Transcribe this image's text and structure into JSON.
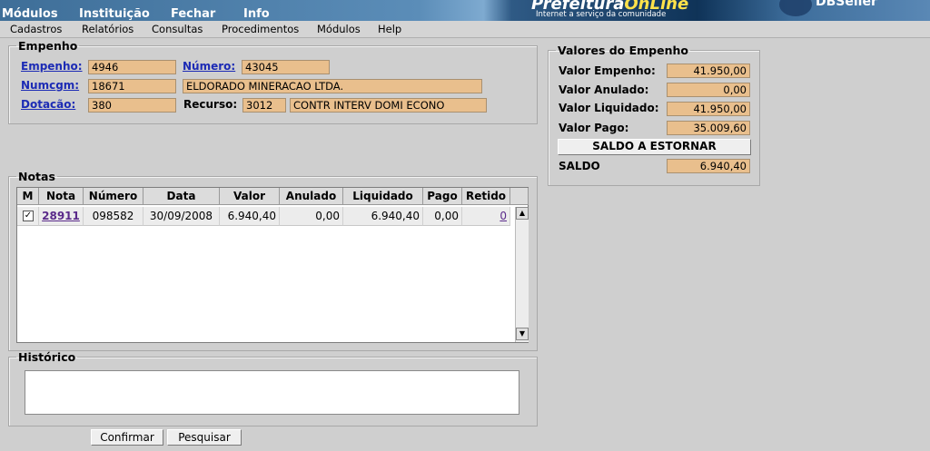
{
  "topbar": {
    "menus": [
      "Módulos",
      "Instituição",
      "Fechar",
      "Info"
    ],
    "brand_main": "Prefeitura",
    "brand_on": "OnLine",
    "brand_sub": "Internet a serviço da comunidade",
    "brand2": "DBSeller"
  },
  "menubar": [
    "Cadastros",
    "Relatórios",
    "Consultas",
    "Procedimentos",
    "Módulos",
    "Help"
  ],
  "empenho": {
    "legend": "Empenho",
    "empenho_label": "Empenho:",
    "empenho_value": "4946",
    "numero_label": "Número:",
    "numero_value": "43045",
    "numcgm_label": "Numcgm:",
    "numcgm_value": "18671",
    "nome_value": "ELDORADO MINERACAO LTDA.",
    "dotacao_label": "Dotacão:",
    "dotacao_value": "380",
    "recurso_label": "Recurso:",
    "recurso_value": "3012",
    "recurso_desc": "CONTR INTERV DOMI ECONO"
  },
  "valores": {
    "legend": "Valores do Empenho",
    "empenho_label": "Valor Empenho:",
    "empenho_value": "41.950,00",
    "anulado_label": "Valor Anulado:",
    "anulado_value": "0,00",
    "liquidado_label": "Valor Liquidado:",
    "liquidado_value": "41.950,00",
    "pago_label": "Valor Pago:",
    "pago_value": "35.009,60",
    "saldo_button": "SALDO A ESTORNAR",
    "saldo_label": "SALDO",
    "saldo_value": "6.940,40"
  },
  "notas": {
    "legend": "Notas",
    "headers": [
      "M",
      "Nota",
      "Número",
      "Data",
      "Valor",
      "Anulado",
      "Liquidado",
      "Pago",
      "Retido"
    ],
    "row": {
      "checked": "✓",
      "nota": "28911",
      "numero": "098582",
      "data": "30/09/2008",
      "valor": "6.940,40",
      "anulado": "0,00",
      "liquidado": "6.940,40",
      "pago": "0,00",
      "retido": "0"
    }
  },
  "historico": {
    "legend": "Histórico",
    "value": ""
  },
  "buttons": {
    "confirmar": "Confirmar",
    "pesquisar": "Pesquisar"
  }
}
